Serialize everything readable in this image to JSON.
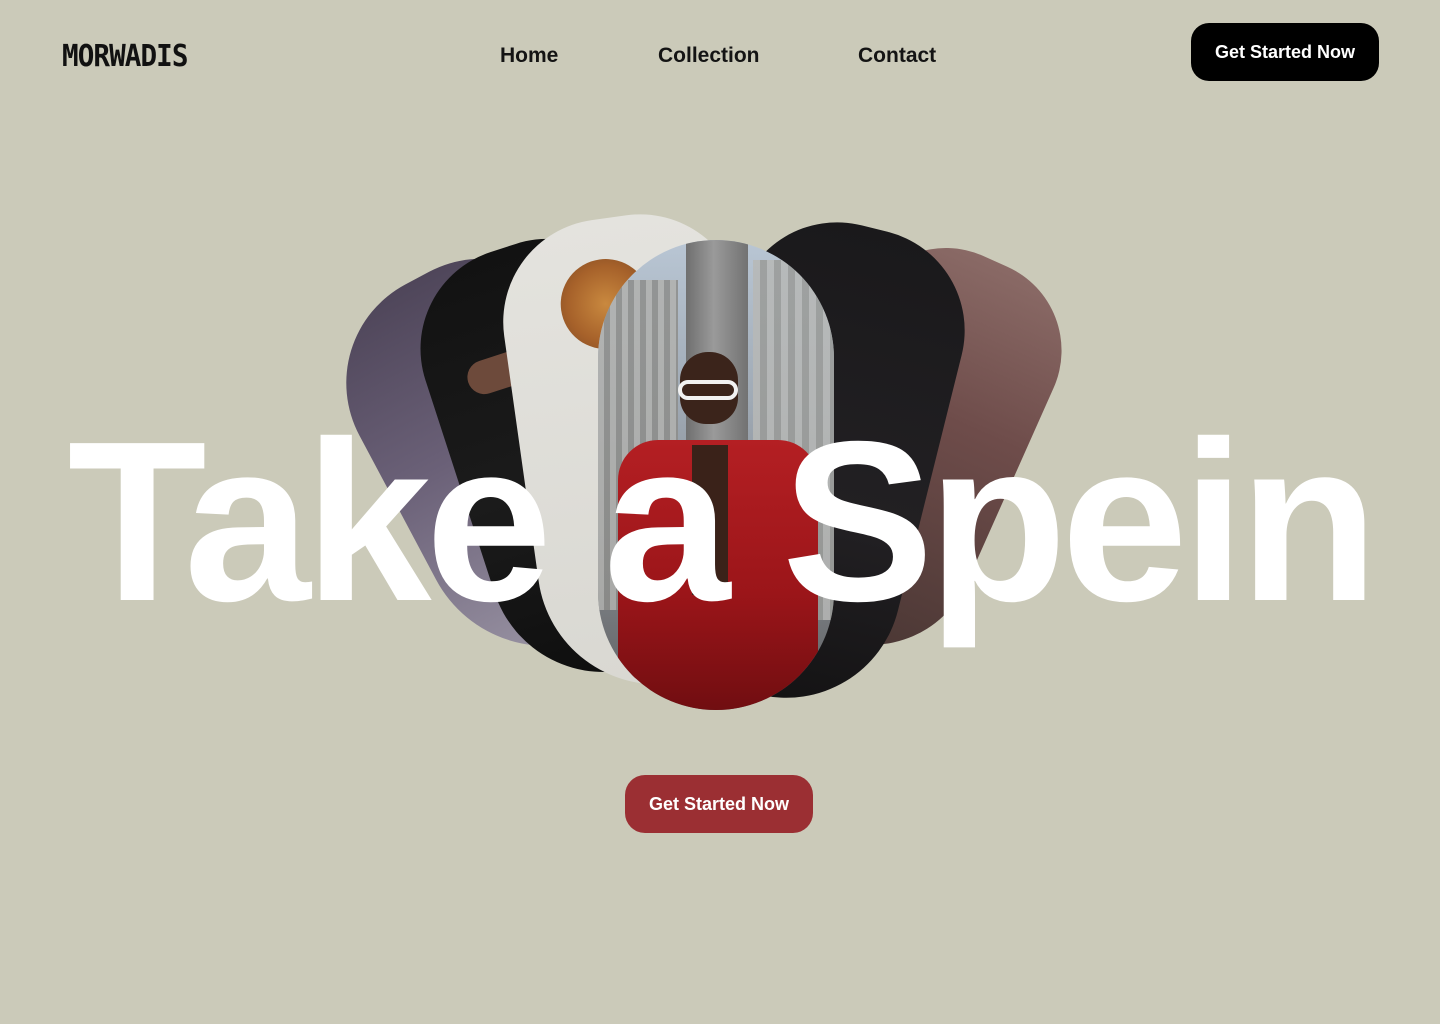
{
  "brand": {
    "logo": "MORWADIS"
  },
  "nav": {
    "items": [
      {
        "label": "Home"
      },
      {
        "label": "Collection"
      },
      {
        "label": "Contact"
      }
    ],
    "cta_label": "Get Started Now"
  },
  "hero": {
    "title": "Take a Spein",
    "cta_label": "Get Started Now"
  },
  "colors": {
    "background": "#cbcab9",
    "text_primary": "#141414",
    "hero_text": "#ffffff",
    "nav_cta_bg": "#000000",
    "hero_cta_bg": "#9b2f33"
  }
}
